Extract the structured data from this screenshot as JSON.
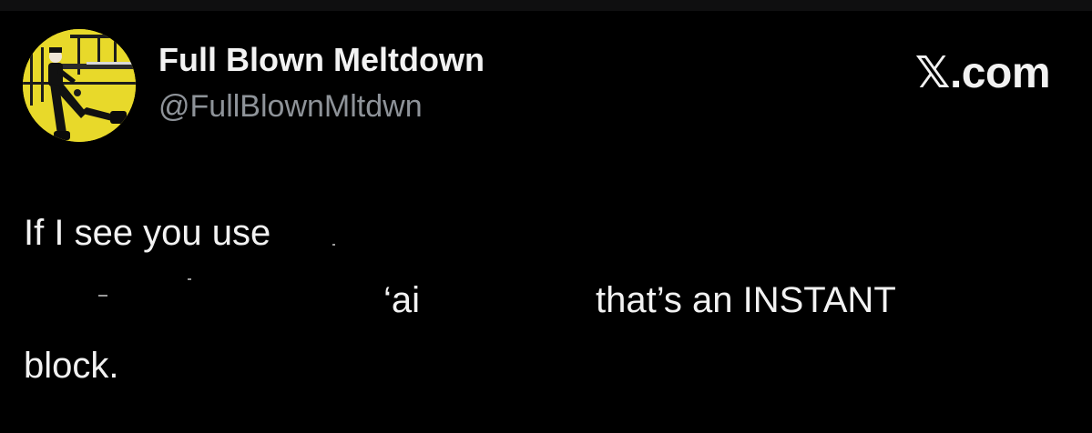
{
  "header": {
    "display_name": "Full Blown Meltdown",
    "handle": "@FullBlownMltdwn",
    "brand": ".com",
    "brand_icon": "x-logo-icon"
  },
  "avatar": {
    "icon": "profile-photo-avatar",
    "background_color": "#e8d92a"
  },
  "tweet": {
    "line1": "If I see you use",
    "line2a": "‘ai",
    "line2b": "that’s an INSTANT",
    "line3": "block."
  },
  "colors": {
    "background": "#000000",
    "text": "#f2f2f2",
    "handle": "#8e9399"
  }
}
